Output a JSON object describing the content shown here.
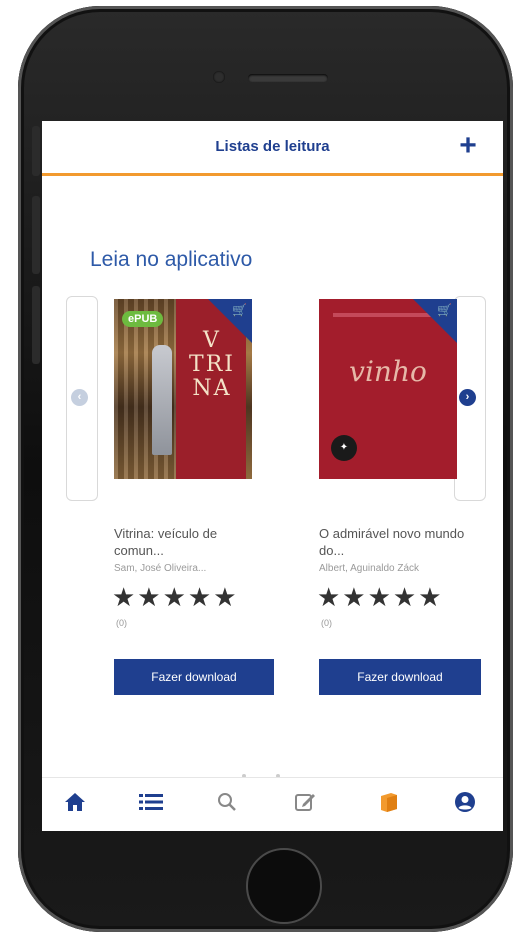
{
  "header": {
    "title": "Listas de leitura",
    "add_icon": "plus-icon"
  },
  "section": {
    "title": "Leia no aplicativo"
  },
  "carousel": {
    "prev_icon": "chevron-left-icon",
    "next_icon": "chevron-right-icon",
    "books": [
      {
        "badge": "ePUB",
        "cover_text": "V TRI NA",
        "title": "Vitrina: veículo de comun...",
        "author": "Sam, José Oliveira...",
        "stars": "★★★★★",
        "rating_count": "(0)",
        "download_label": "Fazer download",
        "corner_icon": "cart-icon"
      },
      {
        "cover_text": "vinho",
        "title": "O admirável novo mundo do...",
        "author": "Albert, Aguinaldo Záck",
        "stars": "★★★★★",
        "rating_count": "(0)",
        "download_label": "Fazer download",
        "corner_icon": "cart-icon"
      }
    ]
  },
  "tabbar": {
    "items": [
      {
        "name": "home",
        "icon": "home-icon"
      },
      {
        "name": "list",
        "icon": "list-icon"
      },
      {
        "name": "search",
        "icon": "search-icon"
      },
      {
        "name": "edit",
        "icon": "edit-icon"
      },
      {
        "name": "books",
        "icon": "books-icon",
        "active": true
      },
      {
        "name": "profile",
        "icon": "profile-icon"
      }
    ]
  },
  "colors": {
    "primary": "#1f3f8f",
    "accent": "#f29a2e",
    "epub_badge": "#6dbb3f",
    "cover_red": "#a31d2c"
  }
}
